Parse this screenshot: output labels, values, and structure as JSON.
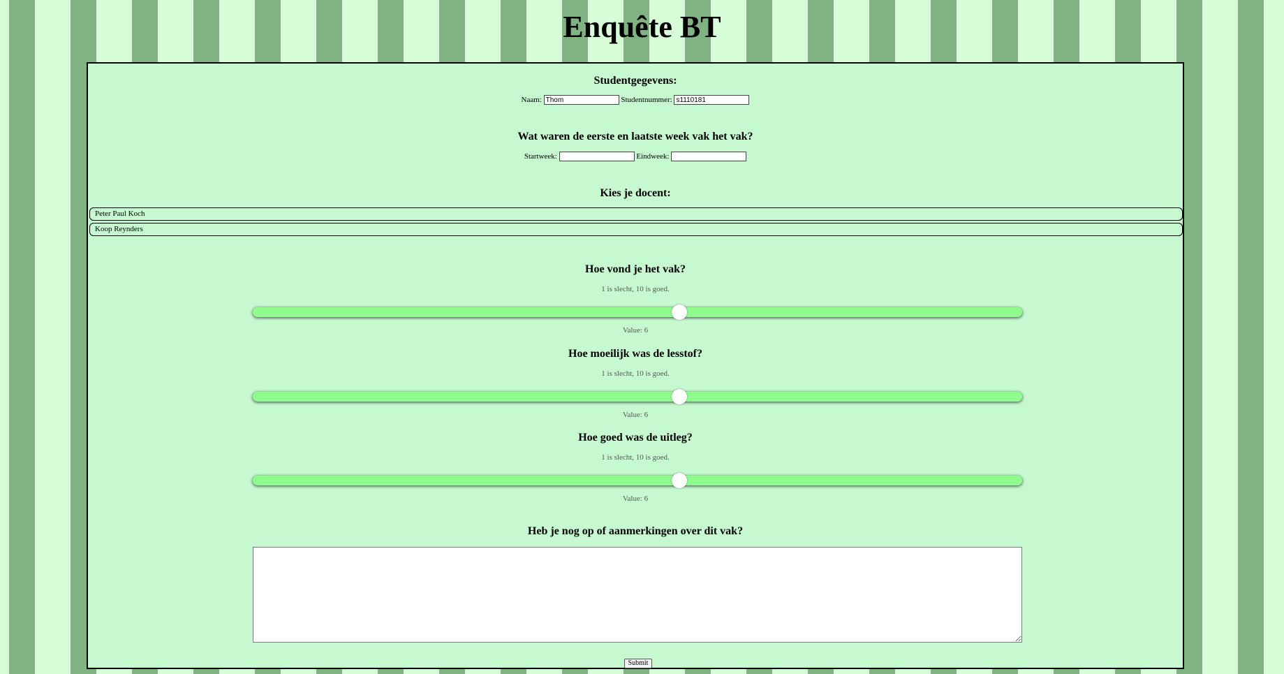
{
  "page": {
    "title": "Enquête BT"
  },
  "student": {
    "heading": "Studentgegevens:",
    "name_label": "Naam:",
    "name_value": "Thom",
    "number_label": "Studentnummer:",
    "number_value": "s1110181"
  },
  "weeks": {
    "heading": "Wat waren de eerste en laatste week vak het vak?",
    "start_label": "Startweek:",
    "start_value": "",
    "end_label": "Eindweek:",
    "end_value": ""
  },
  "teacher": {
    "heading": "Kies je docent:",
    "options": [
      "Peter Paul Koch",
      "Koop Reynders"
    ]
  },
  "ratings": [
    {
      "question": "Hoe vond je het vak?",
      "hint": "1 is slecht, 10 is goed.",
      "value_text": "Value: 6",
      "value": 6,
      "min": 1,
      "max": 10
    },
    {
      "question": "Hoe moeilijk was de lesstof?",
      "hint": "1 is slecht, 10 is goed.",
      "value_text": "Value: 6",
      "value": 6,
      "min": 1,
      "max": 10
    },
    {
      "question": "Hoe goed was de uitleg?",
      "hint": "1 is slecht, 10 is goed.",
      "value_text": "Value: 6",
      "value": 6,
      "min": 1,
      "max": 10
    }
  ],
  "comments": {
    "heading": "Heb je nog op of aanmerkingen over dit vak?",
    "value": ""
  },
  "submit": {
    "label": "Submit"
  },
  "colors": {
    "stripe_light": "#d6fdd7",
    "stripe_dark": "#80b381",
    "panel_background": "#c6f9d0",
    "slider_track": "#8ffc8e"
  }
}
